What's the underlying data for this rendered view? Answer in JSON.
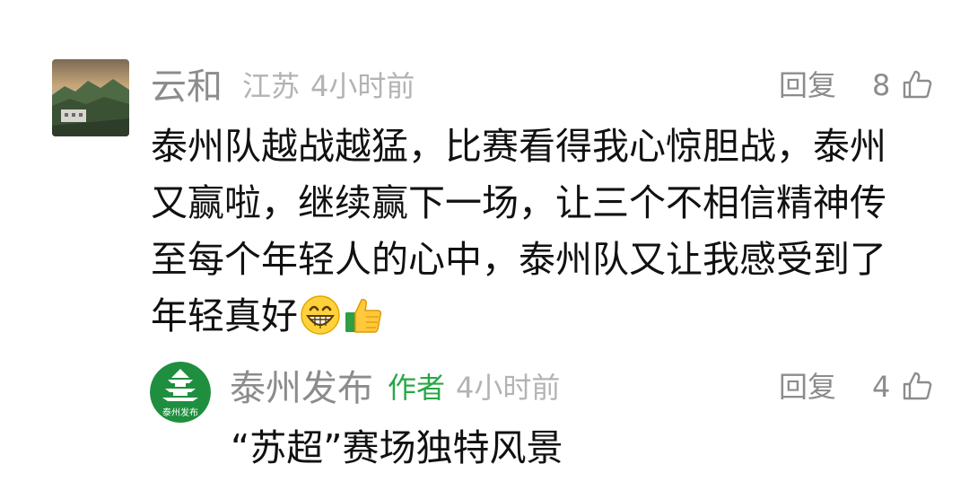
{
  "comment": {
    "user_name": "云和",
    "location": "江苏",
    "time": "4小时前",
    "reply_label": "回复",
    "like_count": "8",
    "text": "泰州队越战越猛，比赛看得我心惊胆战，泰州又赢啦，继续赢下一场，让三个不相信精神传至每个年轻人的心中，泰州队又让我感受到了年轻真好",
    "emojis": [
      "grinning-face-emoji",
      "thumbs-up-emoji"
    ]
  },
  "reply": {
    "user_name": "泰州发布",
    "author_tag": "作者",
    "time": "4小时前",
    "reply_label": "回复",
    "like_count": "4",
    "text": "“苏超”赛场独特风景",
    "avatar_text": "泰州发布"
  },
  "colors": {
    "name_gray": "#8c8c8c",
    "meta_gray": "#b3b3b3",
    "author_green": "#27a845",
    "text_dark": "#111111",
    "avatar_green": "#1f8f3f"
  }
}
